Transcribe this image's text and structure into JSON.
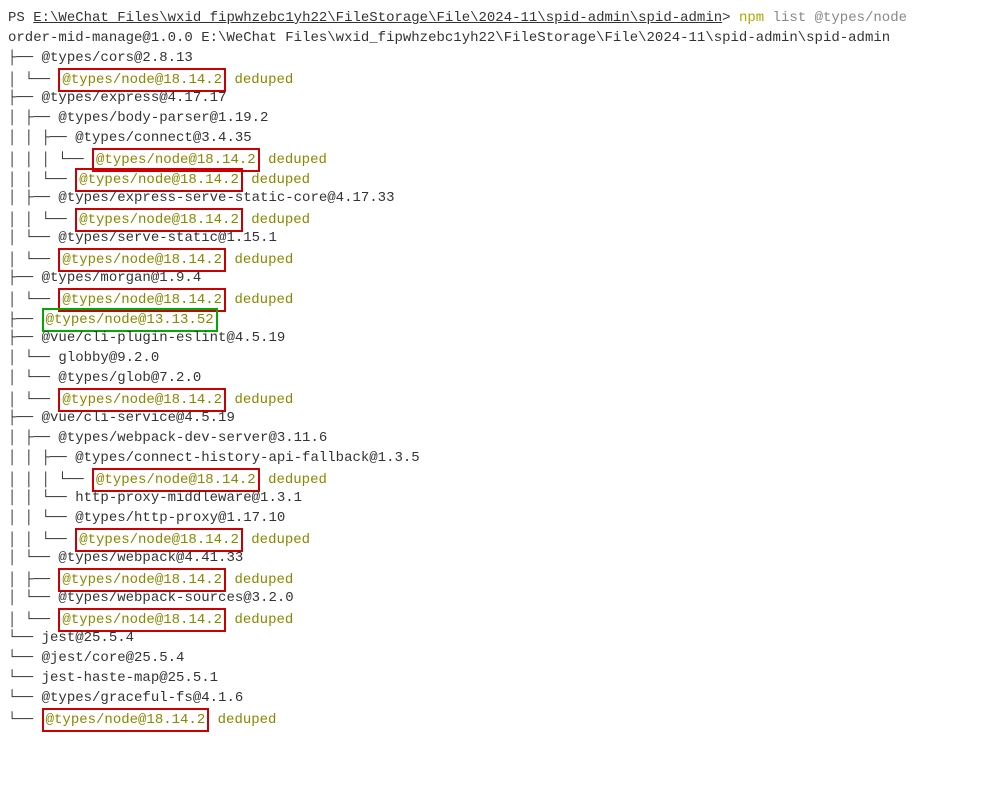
{
  "prompt": {
    "ps": "PS ",
    "path": "E:\\WeChat Files\\wxid_fipwhzebc1yh22\\FileStorage\\File\\2024-11\\spid-admin\\spid-admin",
    "gt": "> ",
    "cmd_npm": "npm",
    "cmd_list": " list",
    "cmd_arg": " @types/node"
  },
  "header": {
    "pkg": "order-mid-manage@1.0.0",
    "dir": " E:\\WeChat Files\\wxid_fipwhzebc1yh22\\FileStorage\\File\\2024-11\\spid-admin\\spid-admin"
  },
  "lines": {
    "l1": "├── @types/cors@2.8.13",
    "l2": "│ └── @types/node@18.14.2",
    "l3": "├── @types/express@4.17.17",
    "l4": "│ ├── @types/body-parser@1.19.2",
    "l5": "│ │ ├── @types/connect@3.4.35",
    "l6": "│ │ │ └── @types/node@18.14.2",
    "l7": "│ │ └── @types/node@18.14.2",
    "l8": "│ ├── @types/express-serve-static-core@4.17.33",
    "l9": "│ │ └── @types/node@18.14.2",
    "l10": "│ └── @types/serve-static@1.15.1",
    "l11": "│   └── @types/node@18.14.2",
    "l12": "├── @types/morgan@1.9.4",
    "l13": "│ └── @types/node@18.14.2",
    "l14": "├── @types/node@13.13.52",
    "l15": "├── @vue/cli-plugin-eslint@4.5.19",
    "l16": "│ └── globby@9.2.0",
    "l17": "│   └── @types/glob@7.2.0",
    "l18": "│     └── @types/node@18.14.2",
    "l19": "├── @vue/cli-service@4.5.19",
    "l20": "│ ├── @types/webpack-dev-server@3.11.6",
    "l21": "│ │ ├── @types/connect-history-api-fallback@1.3.5",
    "l22": "│ │ │ └── @types/node@18.14.2",
    "l23": "│ │ └── http-proxy-middleware@1.3.1",
    "l24": "│ │   └── @types/http-proxy@1.17.10",
    "l25": "│ │     └── @types/node@18.14.2",
    "l26": "│ └── @types/webpack@4.41.33",
    "l27": "│   ├── @types/node@18.14.2",
    "l28": "│   └── @types/webpack-sources@3.2.0",
    "l29": "│     └── @types/node@18.14.2",
    "l30": "└── jest@25.5.4",
    "l31": "  └── @jest/core@25.5.4",
    "l32": "    └── jest-haste-map@25.5.1",
    "l33": "      └── @types/graceful-fs@4.1.6",
    "l34": "        └── @types/node@18.14.2"
  },
  "tree": {
    "root_branch": "├── ",
    "root_last": "└── ",
    "pipe": "│ ",
    "pipe2": "│ │ ",
    "pipe3": "│ │ │ ",
    "sp2": "  ",
    "sp4": "    ",
    "sp6": "      ",
    "sp8": "        ",
    "branch": "├── ",
    "last": "└── "
  },
  "pkgs": {
    "cors": "@types/cors@2.8.13",
    "node18": "@types/node@18.14.2",
    "dedup": " deduped",
    "express": "@types/express@4.17.17",
    "bodyparser": "@types/body-parser@1.19.2",
    "connect": "@types/connect@3.4.35",
    "essc": "@types/express-serve-static-core@4.17.33",
    "servestatic": "@types/serve-static@1.15.1",
    "morgan": "@types/morgan@1.9.4",
    "node13": "@types/node@13.13.52",
    "vue_eslint": "@vue/cli-plugin-eslint@4.5.19",
    "globby": "globby@9.2.0",
    "glob": "@types/glob@7.2.0",
    "vue_service": "@vue/cli-service@4.5.19",
    "wds": "@types/webpack-dev-server@3.11.6",
    "chaf": "@types/connect-history-api-fallback@1.3.5",
    "hpm": "http-proxy-middleware@1.3.1",
    "http_proxy": "@types/http-proxy@1.17.10",
    "webpack": "@types/webpack@4.41.33",
    "ws": "@types/webpack-sources@3.2.0",
    "jest": "jest@25.5.4",
    "jest_core": "@jest/core@25.5.4",
    "jhm": "jest-haste-map@25.5.1",
    "gfs": "@types/graceful-fs@4.1.6"
  }
}
